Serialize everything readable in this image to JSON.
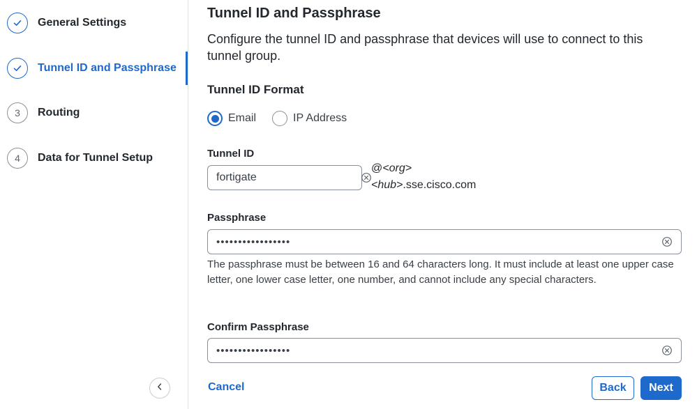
{
  "sidebar": {
    "steps": [
      {
        "label": "General Settings",
        "marker": "",
        "state": "done"
      },
      {
        "label": "Tunnel ID and Passphrase",
        "marker": "",
        "state": "active"
      },
      {
        "label": "Routing",
        "marker": "3",
        "state": "todo"
      },
      {
        "label": "Data for Tunnel Setup",
        "marker": "4",
        "state": "todo"
      }
    ],
    "collapse_icon": "chevron-left-icon"
  },
  "main": {
    "title": "Tunnel ID and Passphrase",
    "description": "Configure the tunnel ID and passphrase that devices will use to connect to this tunnel group.",
    "format_section": {
      "title": "Tunnel ID Format",
      "options": [
        {
          "label": "Email",
          "checked": true
        },
        {
          "label": "IP Address",
          "checked": false
        }
      ]
    },
    "tunnel_id": {
      "label": "Tunnel ID",
      "value": "fortigate",
      "suffix_at": "@",
      "suffix_org": "<org>",
      "suffix_hub": "<hub>",
      "suffix_domain": ".sse.cisco.com"
    },
    "passphrase": {
      "label": "Passphrase",
      "value": "•••••••••••••••••",
      "helper": "The passphrase must be between 16 and 64 characters long. It must include at least one upper case letter, one lower case letter, one number, and cannot include any special characters."
    },
    "confirm_passphrase": {
      "label": "Confirm Passphrase",
      "value": "•••••••••••••••••"
    }
  },
  "footer": {
    "cancel_label": "Cancel",
    "back_label": "Back",
    "next_label": "Next"
  },
  "colors": {
    "accent": "#1d69cc",
    "border": "#8a9099",
    "text": "#23282e"
  }
}
